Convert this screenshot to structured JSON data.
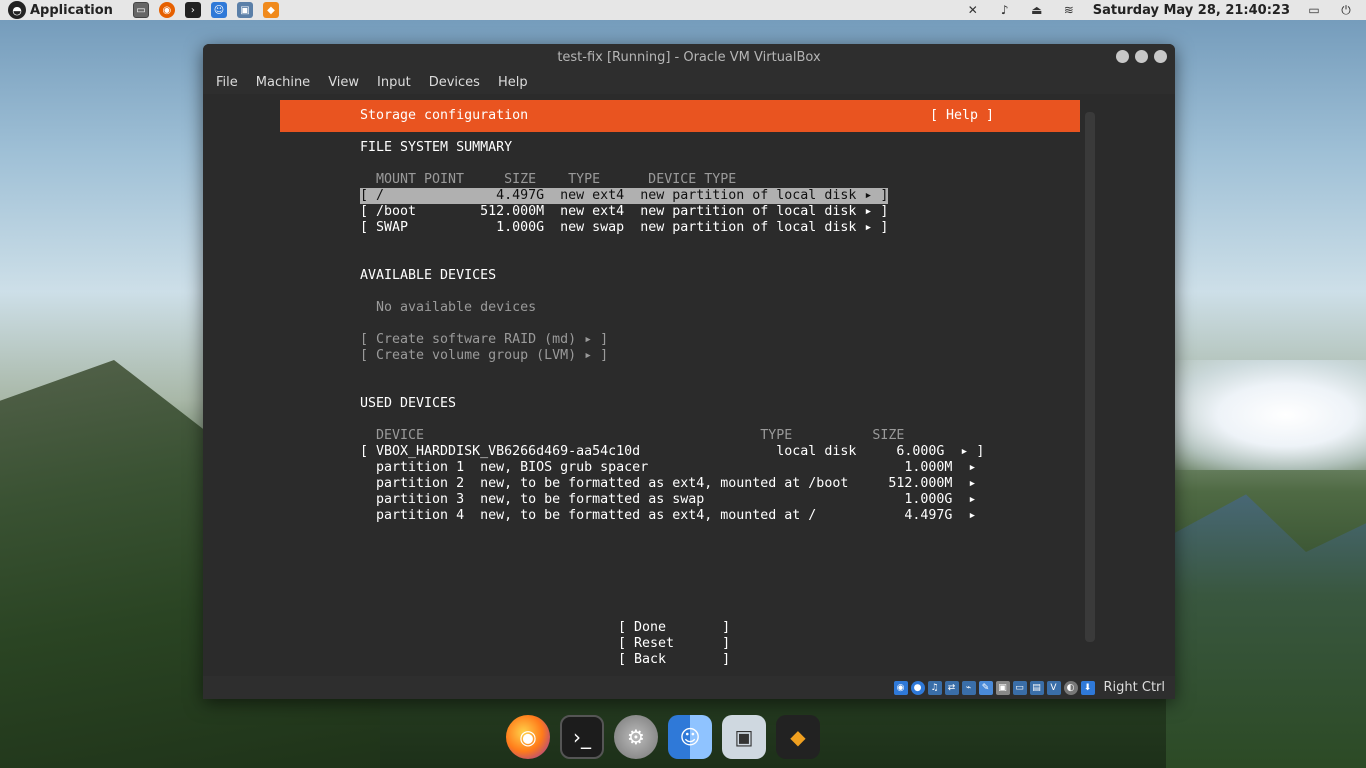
{
  "topbar": {
    "app_label": "Application",
    "clock": "Saturday May 28, 21:40:23"
  },
  "window": {
    "title": "test-fix [Running] - Oracle VM VirtualBox",
    "menu": [
      "File",
      "Machine",
      "View",
      "Input",
      "Devices",
      "Help"
    ]
  },
  "installer": {
    "header_title": "Storage configuration",
    "help_button": "[ Help ]",
    "fs_summary_heading": "FILE SYSTEM SUMMARY",
    "fs_columns": "MOUNT POINT     SIZE    TYPE      DEVICE TYPE",
    "fs_rows": [
      "[ /              4.497G  new ext4  new partition of local disk ▸ ]",
      "[ /boot        512.000M  new ext4  new partition of local disk ▸ ]",
      "[ SWAP           1.000G  new swap  new partition of local disk ▸ ]"
    ],
    "available_heading": "AVAILABLE DEVICES",
    "no_devices": "No available devices",
    "create_raid": "[ Create software RAID (md) ▸ ]",
    "create_lvm": "[ Create volume group (LVM) ▸ ]",
    "used_heading": "USED DEVICES",
    "used_columns": "DEVICE                                          TYPE          SIZE",
    "used_rows": [
      "[ VBOX_HARDDISK_VB6266d469-aa54c10d                 local disk     6.000G  ▸ ]",
      "  partition 1  new, BIOS grub spacer                                1.000M  ▸",
      "  partition 2  new, to be formatted as ext4, mounted at /boot     512.000M  ▸",
      "  partition 3  new, to be formatted as swap                         1.000G  ▸",
      "  partition 4  new, to be formatted as ext4, mounted at /           4.497G  ▸"
    ],
    "buttons": [
      "[ Done       ]",
      "[ Reset      ]",
      "[ Back       ]"
    ]
  },
  "statusbar": {
    "host_key": "Right Ctrl"
  },
  "dock": [
    "firefox-icon",
    "terminal-icon",
    "settings-icon",
    "finder-icon",
    "screenshot-icon",
    "tux-icon"
  ],
  "colors": {
    "ubuntu_orange": "#e95420",
    "vm_background": "#2b2b2b"
  }
}
